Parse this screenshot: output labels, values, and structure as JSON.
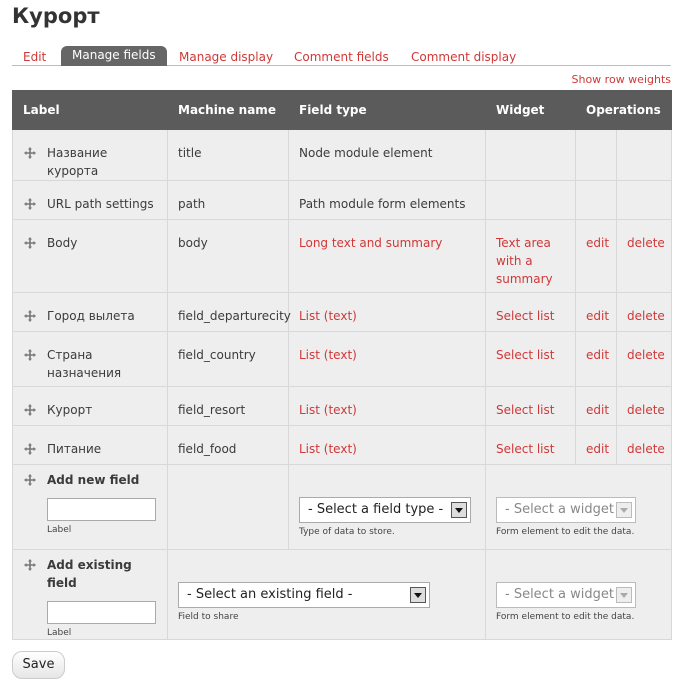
{
  "page": {
    "title": "Курорт"
  },
  "tabs": [
    {
      "label": "Edit"
    },
    {
      "label": "Manage fields"
    },
    {
      "label": "Manage display"
    },
    {
      "label": "Comment fields"
    },
    {
      "label": "Comment display"
    }
  ],
  "show_row_weights": "Show row weights",
  "table": {
    "headers": [
      "Label",
      "Machine name",
      "Field type",
      "Widget",
      "Operations"
    ],
    "rows": [
      {
        "label": "Название курорта",
        "machine": "title",
        "type": "Node module element",
        "widget": "",
        "edit": "",
        "delete": ""
      },
      {
        "label": "URL path settings",
        "machine": "path",
        "type": "Path module form elements",
        "widget": "",
        "edit": "",
        "delete": ""
      },
      {
        "label": "Body",
        "machine": "body",
        "type": "Long text and summary",
        "widget": "Text area with a summary",
        "edit": "edit",
        "delete": "delete"
      },
      {
        "label": "Город вылета",
        "machine": "field_departurecity",
        "type": "List (text)",
        "widget": "Select list",
        "edit": "edit",
        "delete": "delete"
      },
      {
        "label": "Страна назначения",
        "machine": "field_country",
        "type": "List (text)",
        "widget": "Select list",
        "edit": "edit",
        "delete": "delete"
      },
      {
        "label": "Курорт",
        "machine": "field_resort",
        "type": "List (text)",
        "widget": "Select list",
        "edit": "edit",
        "delete": "delete"
      },
      {
        "label": "Питание",
        "machine": "field_food",
        "type": "List (text)",
        "widget": "Select list",
        "edit": "edit",
        "delete": "delete"
      }
    ],
    "add_new": {
      "title": "Add new field",
      "label_help": "Label",
      "type_select": "- Select a field type -",
      "type_help": "Type of data to store.",
      "widget_select": "- Select a widget -",
      "widget_help": "Form element to edit the data."
    },
    "add_existing": {
      "title": "Add existing field",
      "label_help": "Label",
      "field_select": "- Select an existing field -",
      "field_help": "Field to share",
      "widget_select": "- Select a widget -",
      "widget_help": "Form element to edit the data."
    }
  },
  "save_label": "Save",
  "colors": {
    "link": "#d03838",
    "header_bg": "#5b5b5b",
    "row_bg": "#eeeeee",
    "active_tab_bg": "#666666"
  }
}
